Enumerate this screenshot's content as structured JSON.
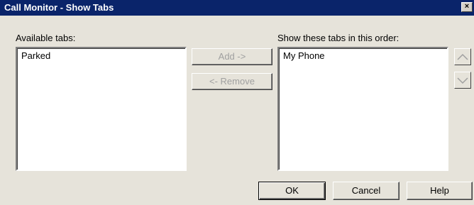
{
  "window": {
    "title": "Call Monitor - Show Tabs",
    "close_glyph": "×"
  },
  "available": {
    "label": "Available tabs:",
    "items": [
      "Parked"
    ]
  },
  "shown": {
    "label": "Show these tabs in this order:",
    "items": [
      "My Phone"
    ]
  },
  "buttons": {
    "add": "Add ->",
    "remove": "<- Remove",
    "ok": "OK",
    "cancel": "Cancel",
    "help": "Help"
  },
  "icons": {
    "move_up": "chevron-up-icon",
    "move_down": "chevron-down-icon"
  }
}
